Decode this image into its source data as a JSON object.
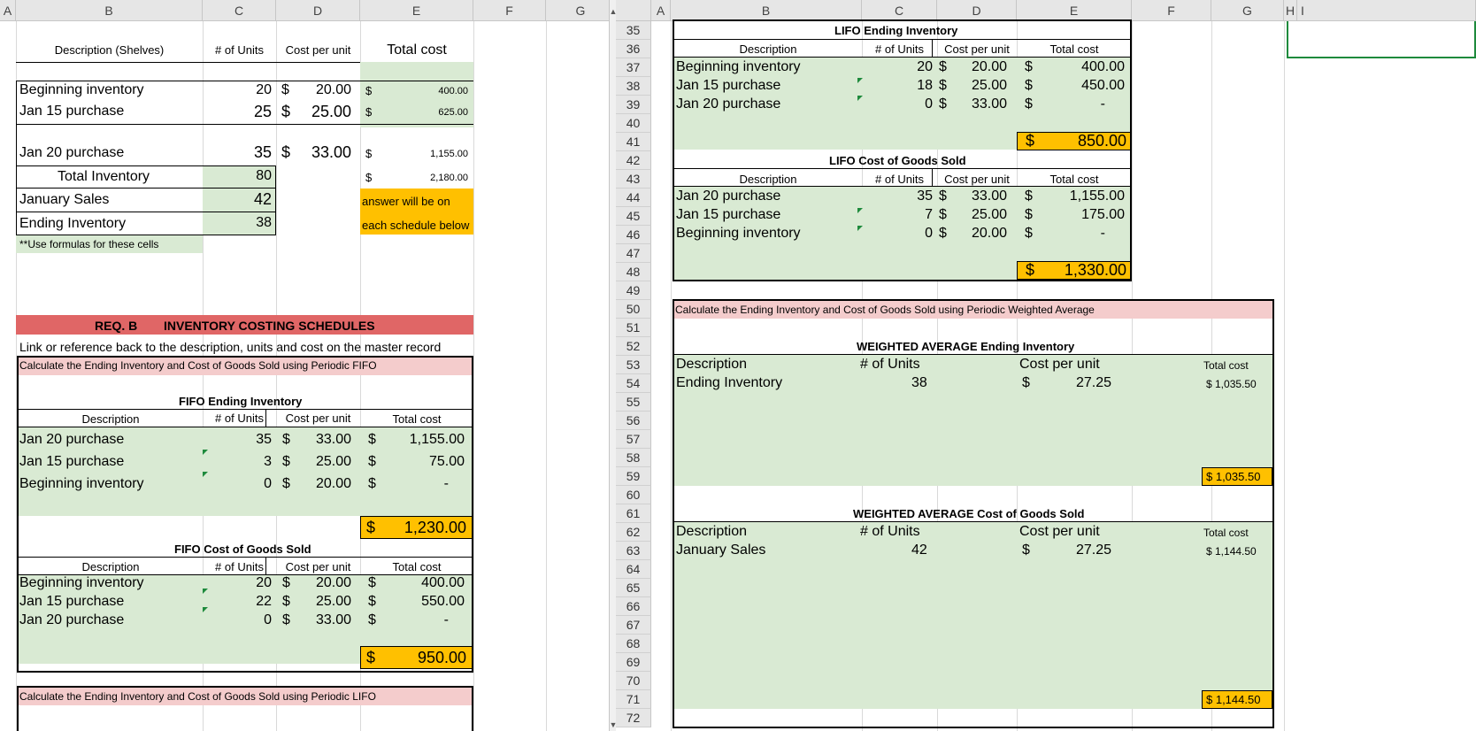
{
  "columns_left": [
    "A",
    "B",
    "C",
    "D",
    "E",
    "F",
    "G"
  ],
  "columns_right": [
    "A",
    "B",
    "C",
    "D",
    "E",
    "F",
    "G",
    "H",
    "I"
  ],
  "row_numbers": [
    "35",
    "36",
    "37",
    "38",
    "39",
    "40",
    "41",
    "42",
    "43",
    "44",
    "45",
    "46",
    "47",
    "48",
    "49",
    "50",
    "51",
    "52",
    "53",
    "54",
    "55",
    "56",
    "57",
    "58",
    "59",
    "60",
    "61",
    "62",
    "63",
    "64",
    "65",
    "66",
    "67",
    "68",
    "69",
    "70",
    "71",
    "72"
  ],
  "left": {
    "hdr_desc": "Description (Shelves)",
    "hdr_units": "# of Units",
    "hdr_cpu": "Cost per unit",
    "hdr_total": "Total cost",
    "master_rows": [
      {
        "desc": "Beginning inventory",
        "units": "20",
        "cur": "$",
        "cpu": "20.00",
        "tcur": "$",
        "total": "400.00"
      },
      {
        "desc": "Jan 15 purchase",
        "units": "25",
        "cur": "$",
        "cpu": "25.00",
        "tcur": "$",
        "total": "625.00"
      },
      {
        "desc": "Jan 20 purchase",
        "units": "35",
        "cur": "$",
        "cpu": "33.00",
        "tcur": "$",
        "total": "1,155.00"
      }
    ],
    "total_inv_label": "Total Inventory",
    "total_inv_units": "80",
    "total_inv_cur": "$",
    "total_inv_value": "2,180.00",
    "jan_sales_label": "January Sales",
    "jan_sales_units": "42",
    "ending_inv_label": "Ending Inventory",
    "ending_inv_units": "38",
    "answer_note_1": "answer will be on",
    "answer_note_2": "each schedule below",
    "formula_note": "**Use formulas for these cells",
    "req_b_label": "REQ. B",
    "req_b_title": "INVENTORY COSTING SCHEDULES",
    "link_note": "Link or reference back to the description, units and cost on the master record",
    "fifo_instr": "Calculate the Ending Inventory and Cost of Goods Sold using Periodic FIFO",
    "fifo_ei_title": "FIFO Ending Inventory",
    "col_desc": "Description",
    "col_units": "# of Units",
    "col_cpu": "Cost per unit",
    "col_total": "Total cost",
    "fifo_ei_rows": [
      {
        "desc": "Jan 20 purchase",
        "units": "35",
        "cur": "$",
        "cpu": "33.00",
        "tcur": "$",
        "total": "1,155.00"
      },
      {
        "desc": "Jan 15 purchase",
        "units": "3",
        "cur": "$",
        "cpu": "25.00",
        "tcur": "$",
        "total": "75.00"
      },
      {
        "desc": "Beginning inventory",
        "units": "0",
        "cur": "$",
        "cpu": "20.00",
        "tcur": "$",
        "total": "-"
      }
    ],
    "fifo_ei_total_cur": "$",
    "fifo_ei_total": "1,230.00",
    "fifo_cogs_title": "FIFO Cost of Goods Sold",
    "fifo_cogs_rows": [
      {
        "desc": "Beginning inventory",
        "units": "20",
        "cur": "$",
        "cpu": "20.00",
        "tcur": "$",
        "total": "400.00"
      },
      {
        "desc": "Jan 15 purchase",
        "units": "22",
        "cur": "$",
        "cpu": "25.00",
        "tcur": "$",
        "total": "550.00"
      },
      {
        "desc": "Jan 20 purchase",
        "units": "0",
        "cur": "$",
        "cpu": "33.00",
        "tcur": "$",
        "total": "-"
      }
    ],
    "fifo_cogs_total_cur": "$",
    "fifo_cogs_total": "950.00",
    "lifo_instr": "Calculate the Ending Inventory and Cost of Goods Sold using Periodic LIFO"
  },
  "right": {
    "lifo_ei_title": "LIFO Ending Inventory",
    "col_desc": "Description",
    "col_units": "# of Units",
    "col_cpu": "Cost per unit",
    "col_total": "Total cost",
    "lifo_ei_rows": [
      {
        "desc": "Beginning inventory",
        "units": "20",
        "cur": "$",
        "cpu": "20.00",
        "tcur": "$",
        "total": "400.00"
      },
      {
        "desc": "Jan 15 purchase",
        "units": "18",
        "cur": "$",
        "cpu": "25.00",
        "tcur": "$",
        "total": "450.00"
      },
      {
        "desc": "Jan 20 purchase",
        "units": "0",
        "cur": "$",
        "cpu": "33.00",
        "tcur": "$",
        "total": "-"
      }
    ],
    "lifo_ei_total_cur": "$",
    "lifo_ei_total": "850.00",
    "lifo_cogs_title": "LIFO Cost of Goods Sold",
    "lifo_cogs_rows": [
      {
        "desc": "Jan 20 purchase",
        "units": "35",
        "cur": "$",
        "cpu": "33.00",
        "tcur": "$",
        "total": "1,155.00"
      },
      {
        "desc": "Jan 15 purchase",
        "units": "7",
        "cur": "$",
        "cpu": "25.00",
        "tcur": "$",
        "total": "175.00"
      },
      {
        "desc": "Beginning inventory",
        "units": "0",
        "cur": "$",
        "cpu": "20.00",
        "tcur": "$",
        "total": "-"
      }
    ],
    "lifo_cogs_total_cur": "$",
    "lifo_cogs_total": "1,330.00",
    "wa_instr": "Calculate the Ending Inventory and Cost of Goods Sold using Periodic Weighted Average",
    "wa_ei_title": "WEIGHTED AVERAGE Ending Inventory",
    "wa_ei_row": {
      "desc": "Ending Inventory",
      "units": "38",
      "cur": "$",
      "cpu": "27.25",
      "total": "$ 1,035.50"
    },
    "wa_ei_total": "$ 1,035.50",
    "wa_cogs_title": "WEIGHTED AVERAGE Cost of Goods Sold",
    "wa_cogs_row": {
      "desc": "January Sales",
      "units": "42",
      "cur": "$",
      "cpu": "27.25",
      "total": "$ 1,144.50"
    },
    "wa_cogs_total": "$ 1,144.50"
  },
  "colors": {
    "green": "#d9ead3",
    "orange": "#ffc000",
    "pink": "#f4cccc",
    "red": "#e06666",
    "selection": "#1e8a3c"
  }
}
